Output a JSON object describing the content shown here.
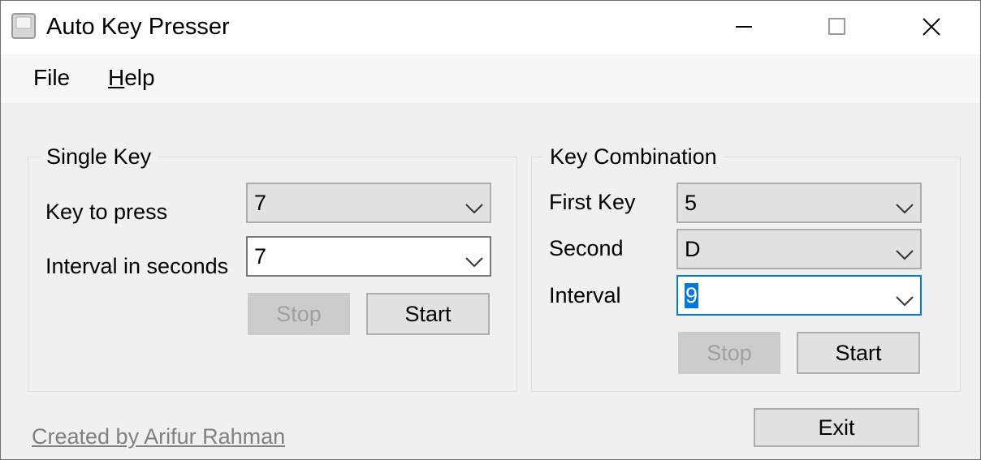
{
  "window": {
    "title": "Auto Key Presser"
  },
  "menu": {
    "file": "File",
    "help_mnemonic": "H",
    "help_rest": "elp"
  },
  "single_key": {
    "legend": "Single Key",
    "key_label": "Key to press",
    "key_value": "7",
    "interval_label": "Interval in seconds",
    "interval_value": "7",
    "stop_label": "Stop",
    "start_label": "Start"
  },
  "combination": {
    "legend": "Key Combination",
    "first_label": "First Key",
    "first_value": "5",
    "second_label": "Second",
    "second_value": "D",
    "interval_label": "Interval",
    "interval_value": "9",
    "stop_label": "Stop",
    "start_label": "Start"
  },
  "footer": {
    "credit": "Created by Arifur Rahman",
    "exit_label": "Exit"
  },
  "colors": {
    "accent": "#0078d7",
    "disabled_text": "#a0a0a0",
    "link": "#808080"
  }
}
